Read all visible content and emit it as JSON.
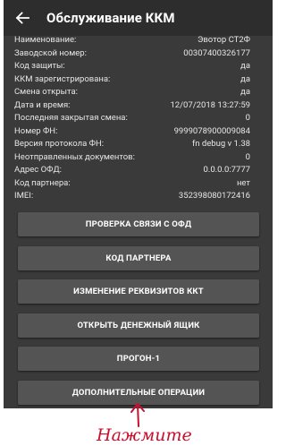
{
  "appbar": {
    "title": "Обслуживание ККМ",
    "back_icon": "arrow-left-icon"
  },
  "info_rows": [
    {
      "key": "Наименование:",
      "value": "Эвотор СТ2Ф"
    },
    {
      "key": "Заводской номер:",
      "value": "00307400326177"
    },
    {
      "key": "Код защиты:",
      "value": "да"
    },
    {
      "key": "ККМ зарегистрирована:",
      "value": "да"
    },
    {
      "key": "Смена открыта:",
      "value": "да"
    },
    {
      "key": "Дата и время:",
      "value": "12/07/2018 13:27:59"
    },
    {
      "key": "Последняя закрытая смена:",
      "value": "0"
    },
    {
      "key": "Номер ФН:",
      "value": "9999078900009084"
    },
    {
      "key": "Версия протокола ФН:",
      "value": "fn debug v 1.38"
    },
    {
      "key": "Неотправленных документов:",
      "value": "0"
    },
    {
      "key": "Адрес ОФД:",
      "value": "0.0.0.0:7777"
    },
    {
      "key": "Код партнера:",
      "value": "нет"
    },
    {
      "key": "IMEI:",
      "value": "352398080172416"
    }
  ],
  "buttons": [
    "ПРОВЕРКА СВЯЗИ С ОФД",
    "КОД ПАРТНЕРА",
    "ИЗМЕНЕНИЕ РЕКВИЗИТОВ ККТ",
    "ОТКРЫТЬ ДЕНЕЖНЫЙ ЯЩИК",
    "ПРОГОН-1",
    "ДОПОЛНИТЕЛЬНЫЕ ОПЕРАЦИИ"
  ],
  "annotation": {
    "text": "Нажмите",
    "color": "#c8102e"
  },
  "colors": {
    "background": "#3a3a3a",
    "appbar": "#2d2d2d",
    "button": "#545454",
    "text": "#ffffff"
  }
}
